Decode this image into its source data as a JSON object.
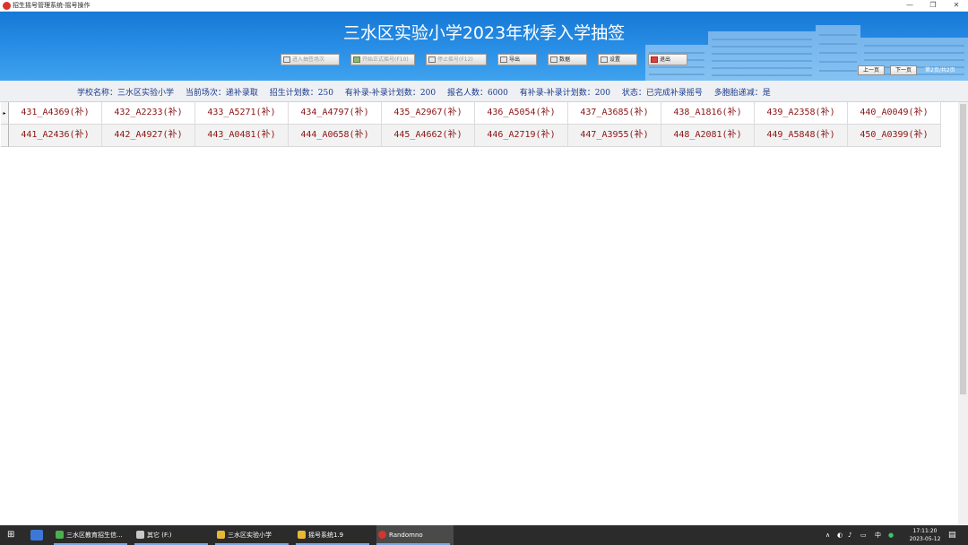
{
  "window": {
    "title": "招生摇号管理系统-摇号操作",
    "min_glyph": "—",
    "max_glyph": "❐",
    "close_glyph": "✕"
  },
  "banner": {
    "heading": "三水区实验小学2023年秋季入学抽签",
    "buttons": [
      {
        "label": "进入抽签场次",
        "enabled": false
      },
      {
        "label": "开始正式摇号(F10)",
        "enabled": false
      },
      {
        "label": "停止摇号(F12)",
        "enabled": false
      },
      {
        "label": "导出",
        "enabled": true
      },
      {
        "label": "数据",
        "enabled": true
      },
      {
        "label": "设置",
        "enabled": true
      },
      {
        "label": "退出",
        "enabled": true
      }
    ],
    "prev_page": "上一页",
    "next_page": "下一页",
    "page_info": "第2页/共2页"
  },
  "info": {
    "school": "学校名称：三水区实验小学",
    "session": "当前场次：递补录取",
    "plan": "招生计划数：250",
    "supplement_plan_1": "有补录-补录计划数：200",
    "applicants": "报名人数：6000",
    "supplement_plan_2": "有补录-补录计划数：200",
    "status": "状态：已完成补录摇号",
    "multi_child": "多胞胎递减：是"
  },
  "grid": {
    "row_pointer": "▸",
    "rows": [
      [
        "431_A4369(补)",
        "432_A2233(补)",
        "433_A5271(补)",
        "434_A4797(补)",
        "435_A2967(补)",
        "436_A5054(补)",
        "437_A3685(补)",
        "438_A1816(补)",
        "439_A2358(补)",
        "440_A0049(补)"
      ],
      [
        "441_A2436(补)",
        "442_A4927(补)",
        "443_A0481(补)",
        "444_A0658(补)",
        "445_A4662(补)",
        "446_A2719(补)",
        "447_A3955(补)",
        "448_A2081(补)",
        "449_A5848(补)",
        "450_A0399(补)"
      ]
    ]
  },
  "taskbar": {
    "items": [
      {
        "label": "三水区教育招生信...",
        "icon_color": "#4caf50"
      },
      {
        "label": "其它 (F:)",
        "icon_color": "#c8c8c8"
      },
      {
        "label": "三水区实验小学",
        "icon_color": "#e8b834"
      },
      {
        "label": "摇号系统1.9",
        "icon_color": "#e8b834"
      },
      {
        "label": "Randomno",
        "icon_color": "#d9342b"
      }
    ],
    "tray_ime": "中",
    "time": "17:11:20",
    "date": "2023-05-12"
  },
  "colors": {
    "banner": "#2a8fe6",
    "cell_text": "#8b1414",
    "info_text": "#1b3a8c"
  }
}
